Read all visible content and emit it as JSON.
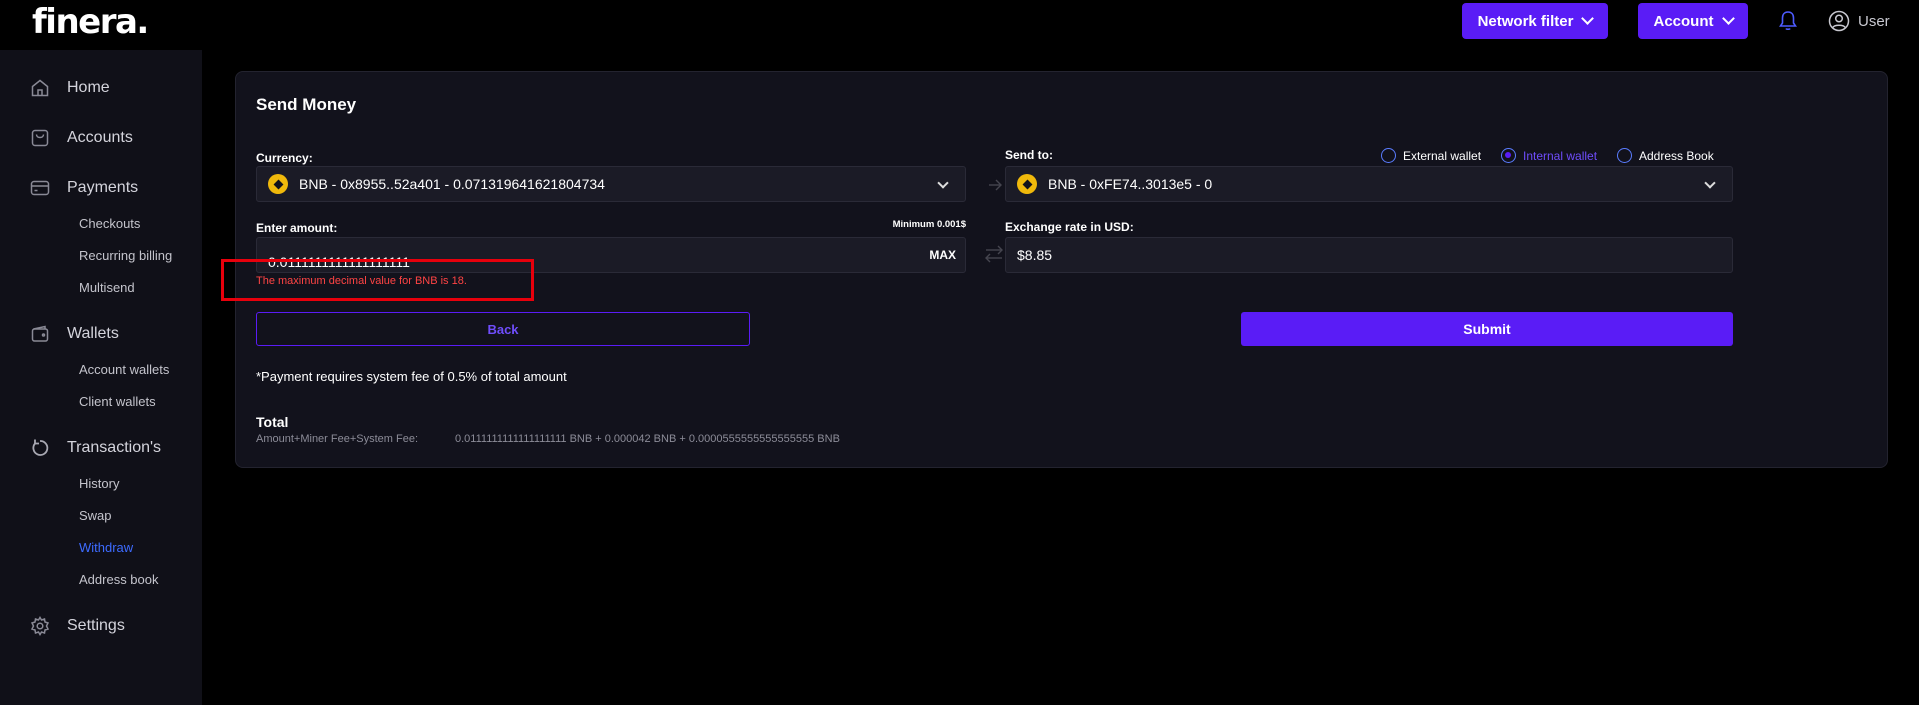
{
  "brand": {
    "logo_text": "finera."
  },
  "header": {
    "network_filter_label": "Network filter",
    "account_label": "Account",
    "user_label": "User"
  },
  "sidebar": {
    "home": "Home",
    "accounts": "Accounts",
    "payments": "Payments",
    "checkouts": "Checkouts",
    "recurring_billing": "Recurring billing",
    "multisend": "Multisend",
    "wallets": "Wallets",
    "account_wallets": "Account wallets",
    "client_wallets": "Client wallets",
    "transactions": "Transaction's",
    "history": "History",
    "swap": "Swap",
    "withdraw": "Withdraw",
    "address_book": "Address book",
    "settings": "Settings",
    "active_item": "Withdraw"
  },
  "form": {
    "title": "Send Money",
    "currency_label": "Currency:",
    "currency_value": "BNB - 0x8955..52a401 - 0.071319641621804734",
    "send_to_label": "Send to:",
    "send_to_options": [
      "External wallet",
      "Internal wallet",
      "Address Book"
    ],
    "send_to_selected": "Internal wallet",
    "send_to_value": "BNB - 0xFE74..3013e5 - 0",
    "amount_label": "Enter amount:",
    "minimum_note": "Minimum 0.001$",
    "amount_value": "0.0111111111111111111",
    "max_label": "MAX",
    "error_message": "The maximum decimal value for BNB is 18.",
    "exchange_rate_label": "Exchange rate in USD:",
    "exchange_rate_value": "$8.85",
    "back_label": "Back",
    "submit_label": "Submit",
    "fee_note": "*Payment requires system fee of 0.5% of total amount",
    "total_title": "Total",
    "total_label": "Amount+Miner Fee+System Fee:",
    "total_value": "0.0111111111111111111 BNB + 0.000042 BNB + 0.0000555555555555555 BNB"
  },
  "colors": {
    "accent": "#5a1cf6",
    "error": "#ff4444",
    "active_nav": "#3d6bff",
    "coin": "#f0b90b"
  }
}
